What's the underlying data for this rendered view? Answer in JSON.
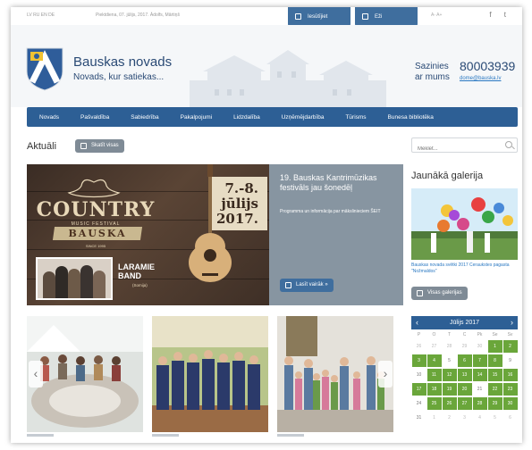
{
  "topbar": {
    "meta": "LV  RU  EN  DE",
    "date": "Piektdiena, 07. jūlijs, 2017. Ādolfs, Mārtiņš",
    "btn1": "Iesūtījiet",
    "btn2": "Eži",
    "lang": "A-  A+",
    "social": "f t"
  },
  "header": {
    "site_name": "Bauskas novads",
    "tagline": "Novads, kur satiekas...",
    "contact_label_1": "Sazinies",
    "contact_label_2": "ar mums",
    "phone": "80003939",
    "email": "dome@bauska.lv"
  },
  "nav": [
    "Novads",
    "Pašvaldība",
    "Sabiedrība",
    "Pakalpojumi",
    "Uzņēmējdarbība",
    "Uzņēmējdarbība",
    "Tūrisms",
    "Bauskas bibliotēka"
  ],
  "nav_display": [
    "Novads",
    "Pašvaldība",
    "Sabiedrība",
    "Pakalpojumi",
    "Lidzdalība",
    "Uzņēmējdarbība",
    "Tūrisms",
    "Bunesa bibliotēka"
  ],
  "aktuali": {
    "title": "Aktuāli",
    "btn": "Skatīt visas"
  },
  "banner": {
    "word": "COUNTRY",
    "sub": "MUSIC FESTIVAL",
    "ribbon": "BAUSKA",
    "since": "SINCE 1995",
    "dates_1": "7.-8.",
    "dates_2": "jūlijs",
    "dates_3": "2017.",
    "band_1": "LARAMIE",
    "band_2": "BAND",
    "band_country": "(Somija)",
    "info_title": "19. Bauskas Kantrimūzikas festivāls jau šonedēļ",
    "info_text": "Programma un informācija par mākslinieciem ŠEIT",
    "info_btn": "Lasīt vairāk »"
  },
  "search": {
    "placeholder": "Meklēt..."
  },
  "gallery": {
    "title": "Jaunākā galerija",
    "caption": "Bauskas novada svētki 2017 Ceraukstes pagasta \"Nožmaldos\"",
    "btn": "Visas galerijas"
  },
  "calendar": {
    "month": "Jūlijs 2017",
    "day_names": [
      "P",
      "O",
      "T",
      "C",
      "Pk",
      "Se",
      "Sv"
    ],
    "weeks": [
      [
        {
          "d": "26",
          "t": "muted"
        },
        {
          "d": "27",
          "t": "muted"
        },
        {
          "d": "28",
          "t": "muted"
        },
        {
          "d": "29",
          "t": "muted"
        },
        {
          "d": "30",
          "t": "muted"
        },
        {
          "d": "1",
          "t": "ev"
        },
        {
          "d": "2",
          "t": "ev"
        }
      ],
      [
        {
          "d": "3",
          "t": "ev"
        },
        {
          "d": "4",
          "t": "ev"
        },
        {
          "d": "5",
          "t": ""
        },
        {
          "d": "6",
          "t": "ev"
        },
        {
          "d": "7",
          "t": "ev"
        },
        {
          "d": "8",
          "t": "ev"
        },
        {
          "d": "9",
          "t": ""
        }
      ],
      [
        {
          "d": "10",
          "t": ""
        },
        {
          "d": "11",
          "t": "ev"
        },
        {
          "d": "12",
          "t": "ev"
        },
        {
          "d": "13",
          "t": "ev"
        },
        {
          "d": "14",
          "t": "ev"
        },
        {
          "d": "15",
          "t": "ev"
        },
        {
          "d": "16",
          "t": "ev"
        }
      ],
      [
        {
          "d": "17",
          "t": "ev"
        },
        {
          "d": "18",
          "t": "ev"
        },
        {
          "d": "19",
          "t": "ev"
        },
        {
          "d": "20",
          "t": "ev"
        },
        {
          "d": "21",
          "t": ""
        },
        {
          "d": "22",
          "t": "ev"
        },
        {
          "d": "23",
          "t": "ev"
        }
      ],
      [
        {
          "d": "24",
          "t": ""
        },
        {
          "d": "25",
          "t": "ev"
        },
        {
          "d": "26",
          "t": "ev"
        },
        {
          "d": "27",
          "t": "ev"
        },
        {
          "d": "28",
          "t": "ev"
        },
        {
          "d": "29",
          "t": "ev"
        },
        {
          "d": "30",
          "t": "ev"
        }
      ],
      [
        {
          "d": "31",
          "t": ""
        },
        {
          "d": "1",
          "t": "muted"
        },
        {
          "d": "2",
          "t": "muted"
        },
        {
          "d": "3",
          "t": "muted"
        },
        {
          "d": "4",
          "t": "muted"
        },
        {
          "d": "5",
          "t": "muted"
        },
        {
          "d": "6",
          "t": "muted"
        }
      ]
    ]
  },
  "colors": {
    "nav": "#2d5f95",
    "event": "#6aa63a",
    "brand_text": "#2a4a75"
  }
}
